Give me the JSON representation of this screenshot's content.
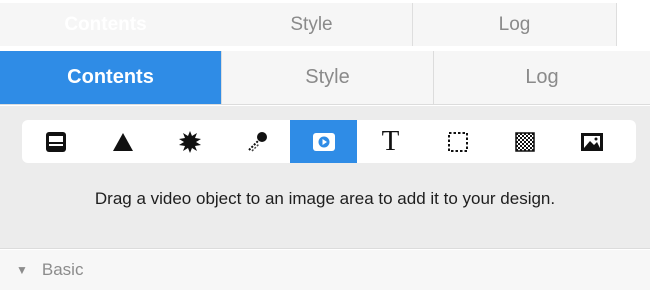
{
  "tabs_top": [
    {
      "label": "Contents",
      "active": true
    },
    {
      "label": "Style",
      "active": false
    },
    {
      "label": "Log",
      "active": false
    }
  ],
  "tabs_main": [
    {
      "label": "Contents",
      "active": true
    },
    {
      "label": "Style",
      "active": false
    },
    {
      "label": "Log",
      "active": false
    }
  ],
  "toolbar": {
    "tools": [
      {
        "icon": "text-box-icon"
      },
      {
        "icon": "triangle-icon"
      },
      {
        "icon": "starburst-icon"
      },
      {
        "icon": "brush-icon"
      },
      {
        "icon": "video-icon",
        "selected": true
      },
      {
        "icon": "text-tool-icon",
        "glyph": "T"
      },
      {
        "icon": "selection-frame-icon"
      },
      {
        "icon": "pattern-icon"
      },
      {
        "icon": "image-icon"
      }
    ]
  },
  "hint": {
    "text": "Drag a video object to an image area to add it to your design."
  },
  "section": {
    "label": "Basic"
  },
  "colors": {
    "accent": "#2f8ce6",
    "panel_bg": "#ececec",
    "tab_bg": "#f6f6f6"
  }
}
